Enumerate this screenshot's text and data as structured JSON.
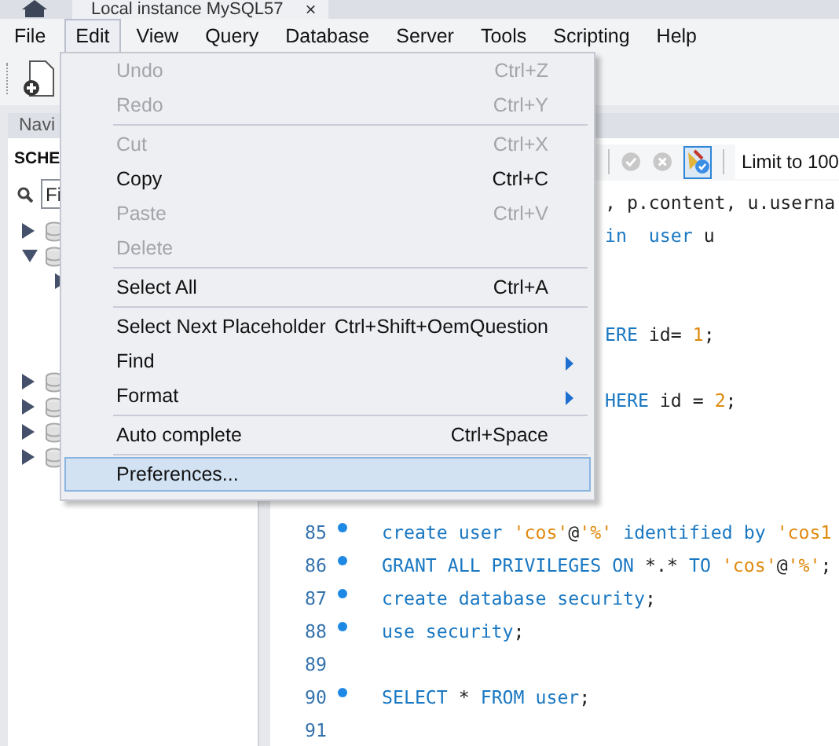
{
  "window_tab": {
    "title": "Local instance MySQL57",
    "close": "×"
  },
  "menu_bar": [
    {
      "label": "File",
      "selected": false
    },
    {
      "label": "Edit",
      "selected": true
    },
    {
      "label": "View",
      "selected": false
    },
    {
      "label": "Query",
      "selected": false
    },
    {
      "label": "Database",
      "selected": false
    },
    {
      "label": "Server",
      "selected": false
    },
    {
      "label": "Tools",
      "selected": false
    },
    {
      "label": "Scripting",
      "selected": false
    },
    {
      "label": "Help",
      "selected": false
    }
  ],
  "navigator": {
    "tab": "Navi",
    "heading": "SCHE",
    "search": {
      "placeholder": "Fi"
    },
    "tree": [
      {
        "kind": "node",
        "expanded": false
      },
      {
        "kind": "node",
        "expanded": true,
        "children": [
          {
            "kind": "node",
            "expanded": false
          },
          {
            "kind": "covered"
          },
          {
            "kind": "covered"
          },
          {
            "kind": "covered"
          }
        ]
      },
      {
        "kind": "node",
        "expanded": false
      },
      {
        "kind": "node",
        "expanded": false
      },
      {
        "kind": "node",
        "expanded": false
      },
      {
        "kind": "node",
        "expanded": false
      }
    ]
  },
  "editor": {
    "toolbar": {
      "toggle_on": true,
      "limit": "Limit to 100"
    },
    "lines": [
      {
        "kind": "fragment",
        "tokens": [
          {
            "kind": "plain",
            "text": ", p.content, u.userna"
          }
        ]
      },
      {
        "kind": "fragment",
        "tokens": [
          {
            "kind": "keyword",
            "text": "in  user"
          },
          {
            "kind": "plain",
            "text": " u"
          }
        ]
      },
      {
        "kind": "blank"
      },
      {
        "kind": "blank"
      },
      {
        "kind": "fragment",
        "tokens": [
          {
            "kind": "keyword",
            "text": "ERE "
          },
          {
            "kind": "plain",
            "text": "id= "
          },
          {
            "kind": "number",
            "text": "1"
          },
          {
            "kind": "plain",
            "text": ";"
          }
        ]
      },
      {
        "kind": "blank"
      },
      {
        "kind": "fragment",
        "tokens": [
          {
            "kind": "keyword",
            "text": "HERE "
          },
          {
            "kind": "plain",
            "text": "id = "
          },
          {
            "kind": "number",
            "text": "2"
          },
          {
            "kind": "plain",
            "text": ";"
          }
        ]
      },
      {
        "kind": "blank"
      },
      {
        "kind": "blank"
      },
      {
        "kind": "blank"
      },
      {
        "kind": "code",
        "number": "85",
        "marker": true,
        "tokens": [
          {
            "kind": "keyword",
            "text": "create user "
          },
          {
            "kind": "string",
            "text": "'cos'"
          },
          {
            "kind": "plain",
            "text": "@"
          },
          {
            "kind": "string",
            "text": "'%'"
          },
          {
            "kind": "keyword",
            "text": " identified by "
          },
          {
            "kind": "string",
            "text": "'cos1"
          }
        ]
      },
      {
        "kind": "code",
        "number": "86",
        "marker": true,
        "tokens": [
          {
            "kind": "keyword",
            "text": "GRANT ALL PRIVILEGES ON "
          },
          {
            "kind": "plain",
            "text": "*.*"
          },
          {
            "kind": "keyword",
            "text": " TO "
          },
          {
            "kind": "string",
            "text": "'cos'"
          },
          {
            "kind": "plain",
            "text": "@"
          },
          {
            "kind": "string",
            "text": "'%'"
          },
          {
            "kind": "plain",
            "text": ";"
          }
        ]
      },
      {
        "kind": "code",
        "number": "87",
        "marker": true,
        "tokens": [
          {
            "kind": "keyword",
            "text": "create database security"
          },
          {
            "kind": "plain",
            "text": ";"
          }
        ]
      },
      {
        "kind": "code",
        "number": "88",
        "marker": true,
        "tokens": [
          {
            "kind": "keyword",
            "text": "use security"
          },
          {
            "kind": "plain",
            "text": ";"
          }
        ]
      },
      {
        "kind": "code",
        "number": "89",
        "marker": false
      },
      {
        "kind": "code",
        "number": "90",
        "marker": true,
        "tokens": [
          {
            "kind": "keyword",
            "text": "SELECT "
          },
          {
            "kind": "plain",
            "text": "* "
          },
          {
            "kind": "keyword",
            "text": "FROM user"
          },
          {
            "kind": "plain",
            "text": ";"
          }
        ]
      },
      {
        "kind": "code",
        "number": "91",
        "marker": false
      }
    ]
  },
  "edit_menu": [
    {
      "kind": "item",
      "label": "Undo",
      "shortcut": "Ctrl+Z",
      "disabled": true,
      "submenu": false,
      "selected": false
    },
    {
      "kind": "item",
      "label": "Redo",
      "shortcut": "Ctrl+Y",
      "disabled": true,
      "submenu": false,
      "selected": false
    },
    {
      "kind": "separator"
    },
    {
      "kind": "item",
      "label": "Cut",
      "shortcut": "Ctrl+X",
      "disabled": true,
      "submenu": false,
      "selected": false
    },
    {
      "kind": "item",
      "label": "Copy",
      "shortcut": "Ctrl+C",
      "disabled": false,
      "submenu": false,
      "selected": false
    },
    {
      "kind": "item",
      "label": "Paste",
      "shortcut": "Ctrl+V",
      "disabled": true,
      "submenu": false,
      "selected": false
    },
    {
      "kind": "item",
      "label": "Delete",
      "disabled": true,
      "submenu": false,
      "selected": false
    },
    {
      "kind": "separator"
    },
    {
      "kind": "item",
      "label": "Select All",
      "shortcut": "Ctrl+A",
      "disabled": false,
      "submenu": false,
      "selected": false
    },
    {
      "kind": "separator"
    },
    {
      "kind": "item",
      "label": "Select Next Placeholder",
      "shortcut": "Ctrl+Shift+OemQuestion",
      "disabled": false,
      "submenu": false,
      "selected": false
    },
    {
      "kind": "item",
      "label": "Find",
      "disabled": false,
      "submenu": true,
      "selected": false
    },
    {
      "kind": "item",
      "label": "Format",
      "disabled": false,
      "submenu": true,
      "selected": false
    },
    {
      "kind": "separator"
    },
    {
      "kind": "item",
      "label": "Auto complete",
      "shortcut": "Ctrl+Space",
      "disabled": false,
      "submenu": false,
      "selected": false
    },
    {
      "kind": "separator"
    },
    {
      "kind": "item",
      "label": "Preferences...",
      "disabled": false,
      "submenu": false,
      "selected": true
    }
  ]
}
